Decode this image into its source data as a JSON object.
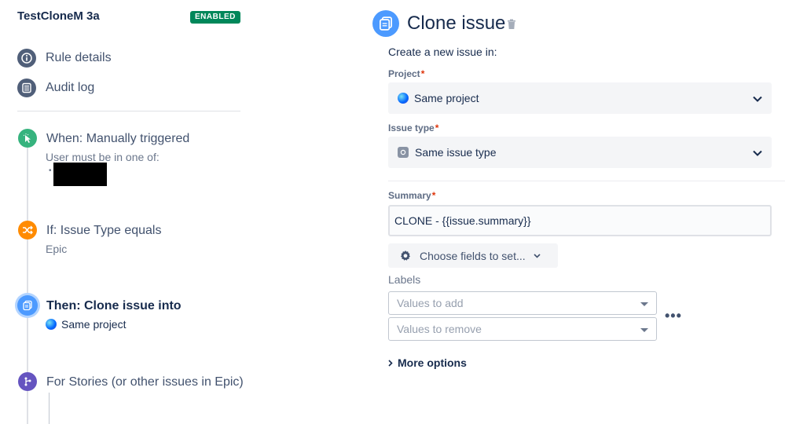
{
  "sidebar": {
    "rule_name": "TestCloneM 3a",
    "status_badge": "ENABLED",
    "nav": [
      {
        "label": "Rule details",
        "icon": "info-icon"
      },
      {
        "label": "Audit log",
        "icon": "list-icon"
      }
    ],
    "steps": [
      {
        "title": "When: Manually triggered",
        "subtitle": "User must be in one of:",
        "icon": "cursor-click-icon",
        "color": "#36b37e"
      },
      {
        "title": "If: Issue Type equals",
        "subtitle": "Epic",
        "icon": "shuffle-icon",
        "color": "#ff8b00"
      },
      {
        "title": "Then: Clone issue into",
        "subtitle": "Same project",
        "icon": "clone-icon",
        "color": "#4c9aff"
      },
      {
        "title": "For Stories (or other issues in Epic)",
        "icon": "branch-icon",
        "color": "#6554c0"
      }
    ]
  },
  "panel": {
    "title": "Clone issue",
    "intro": "Create a new issue in:",
    "project": {
      "label": "Project",
      "value": "Same project"
    },
    "issue_type": {
      "label": "Issue type",
      "value": "Same issue type"
    },
    "summary": {
      "label": "Summary",
      "value": "CLONE - {{issue.summary}}"
    },
    "choose_fields": "Choose fields to set...",
    "labels": {
      "title": "Labels",
      "add_placeholder": "Values to add",
      "remove_placeholder": "Values to remove"
    },
    "more_options": "More options"
  },
  "colors": {
    "badge_green": "#00875a",
    "required": "#de350b",
    "accent_blue": "#4c9aff"
  }
}
